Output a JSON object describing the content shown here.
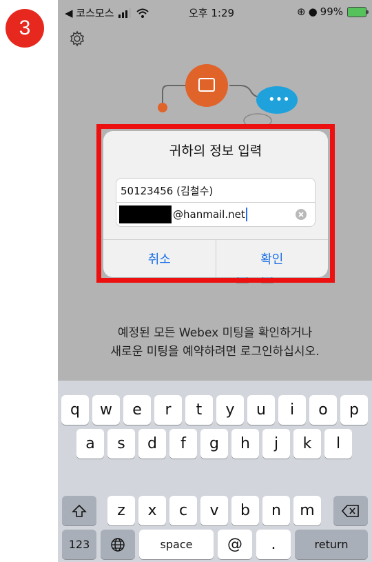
{
  "step_badge": "3",
  "status_bar": {
    "carrier": "◀ 코스모스",
    "time": "오후 1:29",
    "battery_percent": "99%"
  },
  "dialog": {
    "title": "귀하의 정보 입력",
    "field1_value": "50123456 (김철수)",
    "field2_value": "@hanmail.net",
    "cancel_label": "취소",
    "confirm_label": "확인"
  },
  "message": {
    "line1": "예정된 모든 Webex 미팅을 확인하거나",
    "line2": "새로운 미팅을 예약하려면 로그인하십시오."
  },
  "keyboard": {
    "row1": [
      "q",
      "w",
      "e",
      "r",
      "t",
      "y",
      "u",
      "i",
      "o",
      "p"
    ],
    "row2": [
      "a",
      "s",
      "d",
      "f",
      "g",
      "h",
      "j",
      "k",
      "l"
    ],
    "row3": [
      "z",
      "x",
      "c",
      "v",
      "b",
      "n",
      "m"
    ],
    "numbers_label": "123",
    "space_label": "space",
    "at_label": "@",
    "dot_label": ".",
    "return_label": "return"
  },
  "colors": {
    "badge": "#e6281e",
    "highlight": "#ec1010",
    "accent": "#1a6fe6",
    "illustration_orange": "#e0632a",
    "illustration_blue": "#1fa1dc"
  },
  "icons": [
    "settings-gear-icon",
    "wifi-icon",
    "signal-icon",
    "battery-icon",
    "clear-text-icon",
    "shift-icon",
    "backspace-icon",
    "globe-icon"
  ]
}
